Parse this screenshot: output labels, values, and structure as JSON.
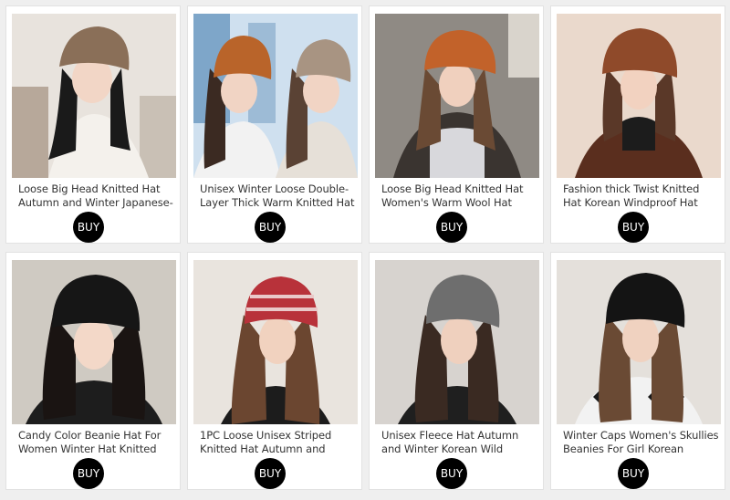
{
  "buy_label": "BUY",
  "products": [
    {
      "title": "Loose Big Head Knitted Hat Autumn and Winter Japanese-",
      "hat_color": "#8a6f58"
    },
    {
      "title": "Unisex Winter Loose Double-Layer Thick Warm Knitted Hat",
      "hat_color": "#b9642a"
    },
    {
      "title": "Loose Big Head Knitted Hat Women's Warm Wool Hat Satin",
      "hat_color": "#c2622a"
    },
    {
      "title": "Fashion thick Twist Knitted Hat Korean Windproof Hat Winter",
      "hat_color": "#8f4a2a"
    },
    {
      "title": "Candy Color Beanie Hat For Women Winter Hat Knitted",
      "hat_color": "#161616"
    },
    {
      "title": "1PC Loose Unisex Striped Knitted Hat Autumn and Winter Ear",
      "hat_color": "#b8323a"
    },
    {
      "title": "Unisex Fleece Hat Autumn and Winter Korean Wild Knitted Hat",
      "hat_color": "#6e6e6e"
    },
    {
      "title": "Winter Caps Women's Skullies Beanies For Girl Korean",
      "hat_color": "#141414"
    }
  ]
}
